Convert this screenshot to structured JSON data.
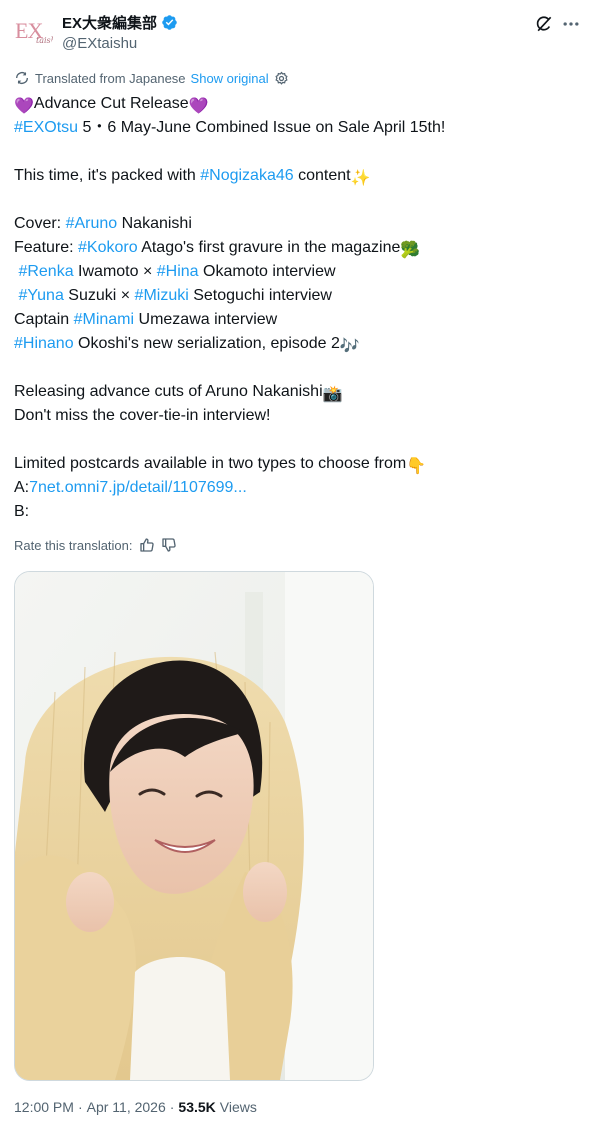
{
  "author": {
    "display_name": "EX大衆編集部",
    "handle": "@EXtaishu",
    "avatar_text": "EX",
    "avatar_subtext": "taishu"
  },
  "translation": {
    "label": "Translated from Japanese",
    "show_original": "Show original",
    "rate_label": "Rate this translation:"
  },
  "tweet": {
    "lines": [
      {
        "segments": [
          {
            "t": "emoji",
            "v": "💜"
          },
          {
            "t": "text",
            "v": "Advance Cut Release"
          },
          {
            "t": "emoji",
            "v": "💜"
          }
        ]
      },
      {
        "segments": [
          {
            "t": "hashtag",
            "v": "#EXOtsu"
          },
          {
            "t": "text",
            "v": " 5・6 May-June Combined Issue on Sale April 15th!"
          }
        ]
      },
      {
        "segments": []
      },
      {
        "segments": [
          {
            "t": "text",
            "v": "This time, it's packed with "
          },
          {
            "t": "hashtag",
            "v": "#Nogizaka46"
          },
          {
            "t": "text",
            "v": " content"
          },
          {
            "t": "emoji",
            "v": "✨"
          }
        ]
      },
      {
        "segments": []
      },
      {
        "segments": [
          {
            "t": "text",
            "v": "Cover: "
          },
          {
            "t": "hashtag",
            "v": "#Aruno"
          },
          {
            "t": "text",
            "v": " Nakanishi"
          }
        ]
      },
      {
        "segments": [
          {
            "t": "text",
            "v": "Feature: "
          },
          {
            "t": "hashtag",
            "v": "#Kokoro"
          },
          {
            "t": "text",
            "v": " Atago's first gravure in the magazine"
          },
          {
            "t": "emoji",
            "v": "🥦"
          }
        ]
      },
      {
        "segments": [
          {
            "t": "text",
            "v": " "
          },
          {
            "t": "hashtag",
            "v": "#Renka"
          },
          {
            "t": "text",
            "v": " Iwamoto × "
          },
          {
            "t": "hashtag",
            "v": "#Hina"
          },
          {
            "t": "text",
            "v": " Okamoto interview"
          }
        ]
      },
      {
        "segments": [
          {
            "t": "text",
            "v": " "
          },
          {
            "t": "hashtag",
            "v": "#Yuna"
          },
          {
            "t": "text",
            "v": " Suzuki × "
          },
          {
            "t": "hashtag",
            "v": "#Mizuki"
          },
          {
            "t": "text",
            "v": " Setoguchi interview"
          }
        ]
      },
      {
        "segments": [
          {
            "t": "text",
            "v": "Captain "
          },
          {
            "t": "hashtag",
            "v": "#Minami"
          },
          {
            "t": "text",
            "v": " Umezawa interview"
          }
        ]
      },
      {
        "segments": [
          {
            "t": "hashtag",
            "v": "#Hinano"
          },
          {
            "t": "text",
            "v": " Okoshi's new serialization, episode 2"
          },
          {
            "t": "emoji",
            "v": "🎶"
          }
        ]
      },
      {
        "segments": []
      },
      {
        "segments": [
          {
            "t": "text",
            "v": "Releasing advance cuts of Aruno Nakanishi"
          },
          {
            "t": "emoji",
            "v": "📸"
          }
        ]
      },
      {
        "segments": [
          {
            "t": "text",
            "v": "Don't miss the cover-tie-in interview!"
          }
        ]
      },
      {
        "segments": []
      },
      {
        "segments": [
          {
            "t": "text",
            "v": "Limited postcards available in two types to choose from"
          },
          {
            "t": "emoji",
            "v": "👇"
          }
        ]
      },
      {
        "segments": [
          {
            "t": "text",
            "v": "A:"
          },
          {
            "t": "link",
            "v": "7net.omni7.jp/detail/1107699..."
          }
        ]
      },
      {
        "segments": [
          {
            "t": "text",
            "v": "B:"
          }
        ]
      }
    ]
  },
  "meta": {
    "time": "12:00 PM",
    "separator": "·",
    "date": "Apr 11, 2026",
    "views_count": "53.5K",
    "views_label": "Views"
  },
  "icons": {
    "verified": "verified-badge-icon",
    "grok": "grok-icon",
    "more": "more-icon",
    "translate": "translate-icon",
    "settings": "gear-icon",
    "thumb_up": "thumb-up-icon",
    "thumb_down": "thumb-down-icon"
  },
  "colors": {
    "link": "#1d9bf0",
    "text": "#0f1419",
    "muted": "#536471",
    "verified": "#1d9bf0"
  }
}
